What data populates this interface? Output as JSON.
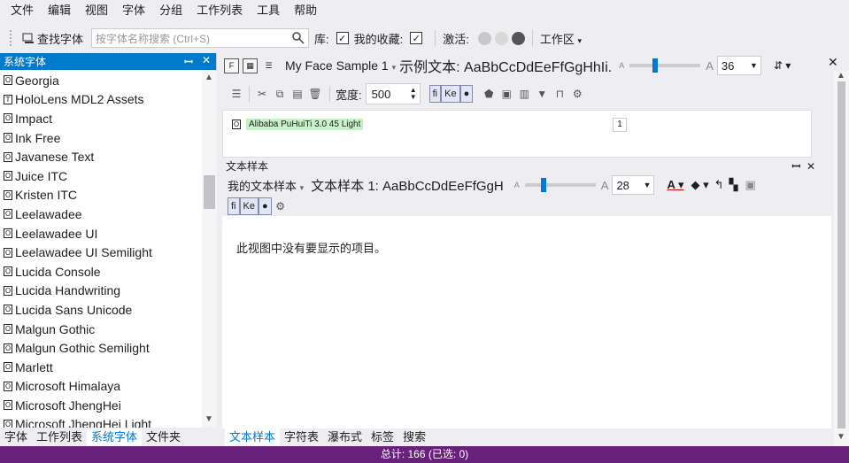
{
  "menu": [
    "文件",
    "编辑",
    "视图",
    "字体",
    "分组",
    "工作列表",
    "工具",
    "帮助"
  ],
  "toolbar": {
    "find_font_label": "查找字体",
    "search_placeholder": "按字体名称搜索 (Ctrl+S)",
    "library_label": "库:",
    "favorites_label": "我的收藏:",
    "activate_label": "激活:",
    "workspace_label": "工作区"
  },
  "left_panel": {
    "title": "系统字体",
    "fonts": [
      "Georgia",
      "HoloLens MDL2 Assets",
      "Impact",
      "Ink Free",
      "Javanese Text",
      "Juice ITC",
      "Kristen ITC",
      "Leelawadee",
      "Leelawadee UI",
      "Leelawadee UI Semilight",
      "Lucida Console",
      "Lucida Handwriting",
      "Lucida Sans Unicode",
      "Malgun Gothic",
      "Malgun Gothic Semilight",
      "Marlett",
      "Microsoft Himalaya",
      "Microsoft JhengHei",
      "Microsoft JhengHei Light"
    ],
    "font_icons": [
      "O",
      "T",
      "O",
      "O",
      "O",
      "O",
      "O",
      "O",
      "O",
      "O",
      "O",
      "O",
      "O",
      "O",
      "O",
      "O",
      "O",
      "O",
      "O"
    ],
    "tabs": [
      "字体",
      "工作列表",
      "系统字体",
      "文件夹"
    ]
  },
  "sample_bar": {
    "sample_name": "My Face Sample 1",
    "sample_text": "示例文本: AaBbCcDdEeFfGgHhIi.",
    "size_small": "A",
    "size_large": "A",
    "size_value": "36"
  },
  "edit_bar": {
    "width_label": "宽度:",
    "width_value": "500"
  },
  "card": {
    "font_tag": "Alibaba PuHuiTi 3.0 45 Light",
    "count": "1"
  },
  "doc_panel": {
    "title": "文本样本",
    "sample_selector": "我的文本样本",
    "sample_text": "文本样本 1:  AaBbCcDdEeFfGgH",
    "size_small": "A",
    "size_large": "A",
    "size_value": "28",
    "empty_message": "此视图中没有要显示的项目。"
  },
  "bottom_tabs": [
    "文本样本",
    "字符表",
    "瀑布式",
    "标签",
    "搜索"
  ],
  "status": "总计: 166 (已选: 0)",
  "colors": {
    "accent": "#007acc",
    "status_bar": "#68217a"
  }
}
